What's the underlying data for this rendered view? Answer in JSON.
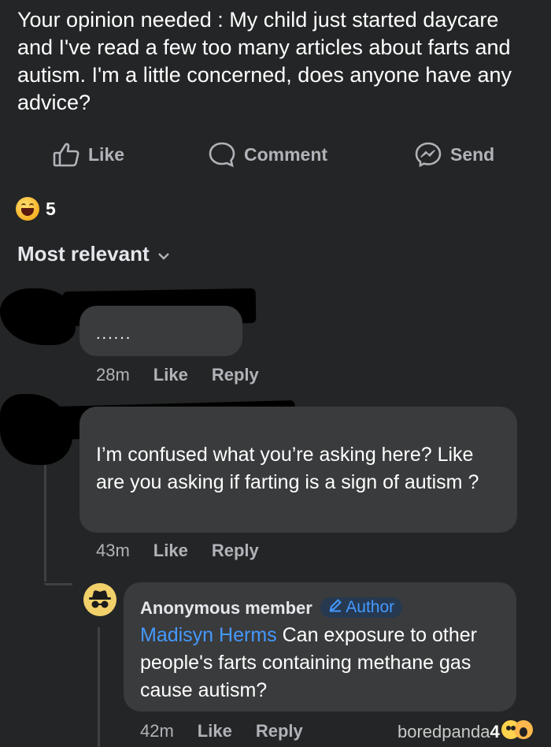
{
  "post": {
    "text": "Your opinion needed : My child just started daycare and I've read a few too many articles about farts and autism. I'm a little concerned, does anyone have any advice?"
  },
  "actions": {
    "like": "Like",
    "comment": "Comment",
    "send": "Send"
  },
  "reactions": {
    "emoji": "haha-emoji",
    "count": "5"
  },
  "sort": {
    "label": "Most relevant"
  },
  "comments": [
    {
      "text": "......",
      "time": "28m",
      "like": "Like",
      "reply": "Reply"
    },
    {
      "text": "I’m confused what you’re asking here? Like are you asking if farting is a sign of autism ?",
      "time": "43m",
      "like": "Like",
      "reply": "Reply"
    }
  ],
  "reply": {
    "author": "Anonymous member",
    "badge": "Author",
    "mention": "Madisyn Herms",
    "text": "Can exposure to other people's farts containing methane gas cause autism?",
    "time": "42m",
    "like": "Like",
    "reply": "Reply"
  },
  "watermark": {
    "text": "boredpanda",
    "suffix": "4"
  },
  "colors": {
    "background": "#242526",
    "bubble": "#3a3b3c",
    "link": "#4599ff",
    "secondary_text": "#b0b3b8"
  }
}
